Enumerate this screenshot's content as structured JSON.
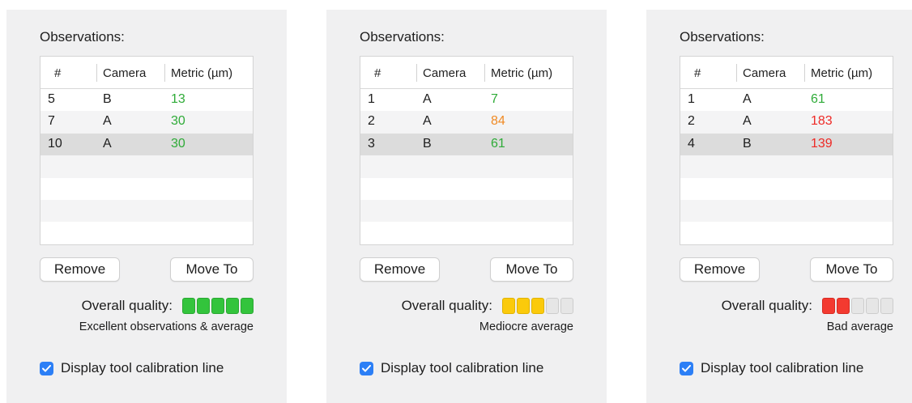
{
  "panels": [
    {
      "title": "Observations:",
      "columns": [
        "#",
        "Camera",
        "Metric (µm)"
      ],
      "rows": [
        {
          "num": "5",
          "camera": "B",
          "metric": "13",
          "color": "#2fab38"
        },
        {
          "num": "7",
          "camera": "A",
          "metric": "30",
          "color": "#2fab38"
        },
        {
          "num": "10",
          "camera": "A",
          "metric": "30",
          "color": "#2fab38"
        }
      ],
      "selected_row": 2,
      "remove_label": "Remove",
      "move_label": "Move To",
      "quality_label": "Overall quality:",
      "quality_level": 5,
      "quality_max": 5,
      "quality_color": "green",
      "caption": "Excellent observations & average",
      "checkbox_label": "Display tool calibration line",
      "checkbox_checked": true
    },
    {
      "title": "Observations:",
      "columns": [
        "#",
        "Camera",
        "Metric (µm)"
      ],
      "rows": [
        {
          "num": "1",
          "camera": "A",
          "metric": "7",
          "color": "#2fab38"
        },
        {
          "num": "2",
          "camera": "A",
          "metric": "84",
          "color": "#f08a24"
        },
        {
          "num": "3",
          "camera": "B",
          "metric": "61",
          "color": "#2fab38"
        }
      ],
      "selected_row": 2,
      "remove_label": "Remove",
      "move_label": "Move To",
      "quality_label": "Overall quality:",
      "quality_level": 3,
      "quality_max": 5,
      "quality_color": "yellow",
      "caption": "Mediocre average",
      "checkbox_label": "Display tool calibration line",
      "checkbox_checked": true
    },
    {
      "title": "Observations:",
      "columns": [
        "#",
        "Camera",
        "Metric (µm)"
      ],
      "rows": [
        {
          "num": "1",
          "camera": "A",
          "metric": "61",
          "color": "#2fab38"
        },
        {
          "num": "2",
          "camera": "A",
          "metric": "183",
          "color": "#ee2a26"
        },
        {
          "num": "4",
          "camera": "B",
          "metric": "139",
          "color": "#ee2a26"
        }
      ],
      "selected_row": 2,
      "remove_label": "Remove",
      "move_label": "Move To",
      "quality_label": "Overall quality:",
      "quality_level": 2,
      "quality_max": 5,
      "quality_color": "red",
      "caption": "Bad average",
      "checkbox_label": "Display tool calibration line",
      "checkbox_checked": true
    }
  ]
}
